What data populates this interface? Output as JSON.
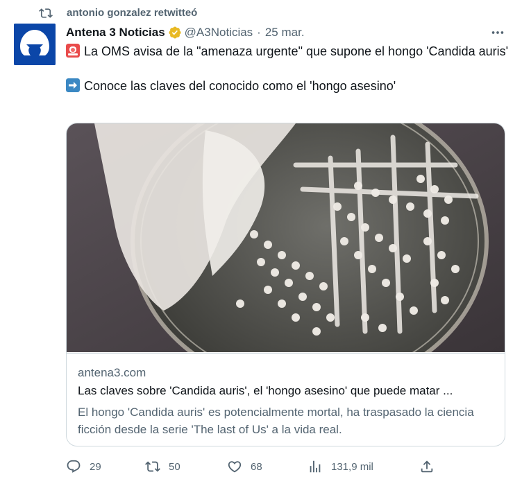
{
  "retweet": {
    "text": "antonio gonzalez retwitteó",
    "icon": "retweet-icon"
  },
  "author": {
    "name": "Antena 3 Noticias",
    "handle": "@A3Noticias",
    "separator": "·",
    "date": "25 mar.",
    "verified_color": "#e8b923",
    "avatar_color": "#0b46a8"
  },
  "tweet": {
    "line1_emoji": "police-light-icon",
    "line1": "La OMS avisa de la \"amenaza urgente\" que supone el hongo 'Candida auris'",
    "line2_emoji": "right-arrow-icon",
    "line2": "Conoce las claves del conocido como el 'hongo asesino'"
  },
  "card": {
    "domain": "antena3.com",
    "title": "Las claves sobre 'Candida auris', el 'hongo asesino' que puede matar ...",
    "description": "El hongo 'Candida auris' es potencialmente mortal, ha traspasado la ciencia ficción desde la serie 'The last of Us' a la vida real."
  },
  "actions": {
    "replies": "29",
    "retweets": "50",
    "likes": "68",
    "views": "131,9 mil"
  },
  "colors": {
    "text": "#0f1419",
    "secondary": "#536471",
    "border": "#cfd9de"
  }
}
